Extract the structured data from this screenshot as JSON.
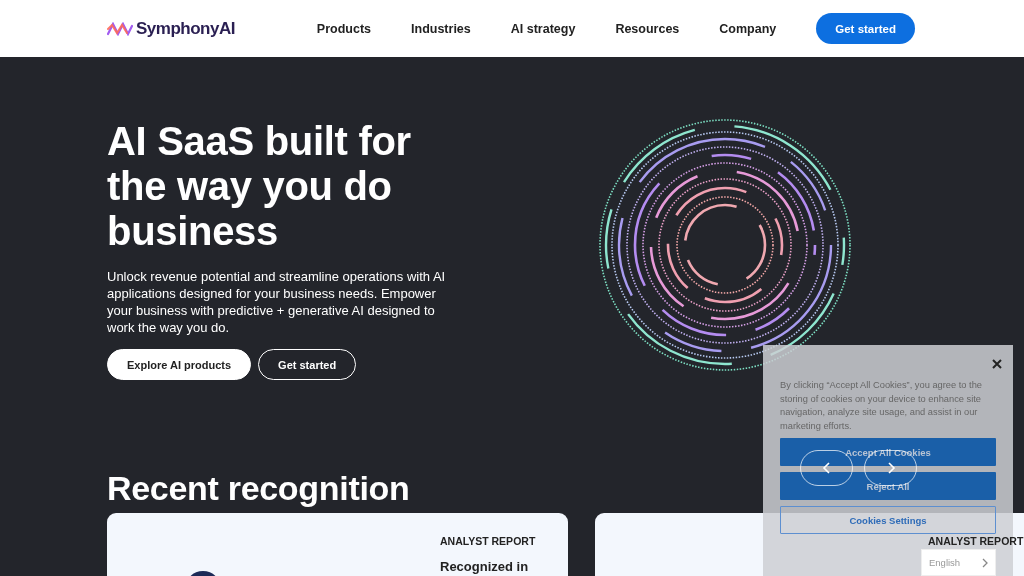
{
  "header": {
    "logo": "SymphonyAI",
    "nav": [
      {
        "label": "Products"
      },
      {
        "label": "Industries"
      },
      {
        "label": "AI strategy"
      },
      {
        "label": "Resources"
      },
      {
        "label": "Company"
      }
    ],
    "cta": "Get started"
  },
  "hero": {
    "title": "AI SaaS built for the way you do business",
    "description": "Unlock revenue potential and streamline operations with AI applications designed for your business needs. Empower your business with predictive + generative AI designed to work the way you do.",
    "buttons": [
      {
        "label": "Explore AI products",
        "kind": "filled"
      },
      {
        "label": "Get started",
        "kind": "outline"
      }
    ]
  },
  "recognition": {
    "heading": "Recent recognition",
    "cards": [
      {
        "label": "ANALYST REPORT",
        "title": "Recognized in",
        "kind": "circle-logo"
      },
      {
        "label": "ANALYST REPORT",
        "kind": "text-only"
      }
    ]
  },
  "cookie_banner": {
    "text": "By clicking “Accept All Cookies”, you agree to the storing of cookies on your device to enhance site navigation, analyze site usage, and assist in our marketing efforts.",
    "buttons": [
      {
        "label": "Accept All Cookies",
        "kind": "filled"
      },
      {
        "label": "Reject All",
        "kind": "filled"
      },
      {
        "label": "Cookies Settings",
        "kind": "outline"
      }
    ]
  },
  "language_selector": {
    "value": "English"
  }
}
